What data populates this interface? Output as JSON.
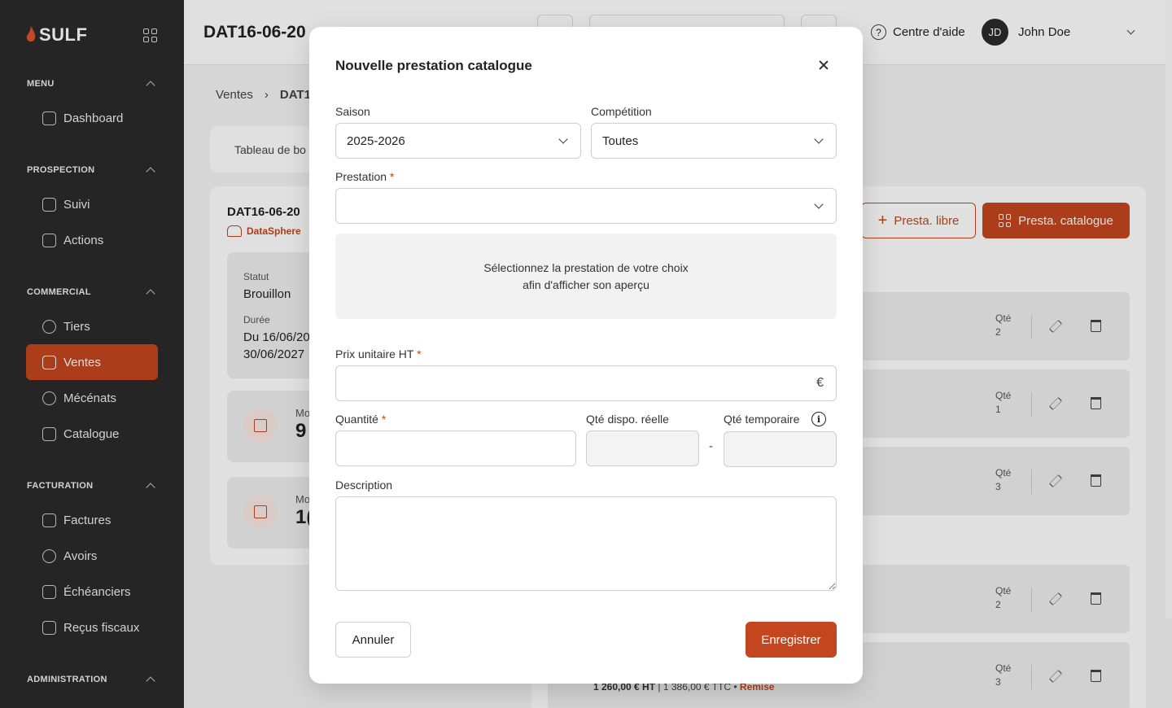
{
  "sidebar": {
    "brand": "SULF",
    "sections": {
      "menu": "MENU",
      "prospection": "PROSPECTION",
      "commercial": "COMMERCIAL",
      "facturation": "FACTURATION",
      "administration": "ADMINISTRATION"
    },
    "items": {
      "dashboard": "Dashboard",
      "suivi": "Suivi",
      "actions": "Actions",
      "tiers": "Tiers",
      "ventes": "Ventes",
      "mecenats": "Mécénats",
      "catalogue": "Catalogue",
      "factures": "Factures",
      "avoirs": "Avoirs",
      "echeanciers": "Échéanciers",
      "recus": "Reçus fiscaux"
    }
  },
  "header": {
    "title": "DAT16-06-20",
    "help": "Centre d'aide",
    "user_initials": "JD",
    "user_name": "John Doe"
  },
  "background": {
    "breadcrumb_root": "Ventes",
    "breadcrumb_current": "DAT16",
    "tab_label": "Tableau de bo",
    "doc_title": "DAT16-06-20",
    "client": "DataSphere",
    "status_label": "Statut",
    "status_value": "Brouillon",
    "duration_label": "Durée",
    "duration_line1": "Du 16/06/20",
    "duration_line2": "30/06/2027",
    "amount1_label": "Mo",
    "amount1_value": "9",
    "amount2_label": "Mo",
    "amount2_value": "1(",
    "btn_libre": "Presta. libre",
    "btn_catalogue": "Presta. catalogue",
    "qty_label": "Qté",
    "rows": [
      "2",
      "1",
      "3",
      "2",
      "3"
    ],
    "bottom_ht": "1 260,00 € HT",
    "bottom_ttc": "1 386,00 € TTC",
    "bottom_remise": "Remise"
  },
  "modal": {
    "title": "Nouvelle prestation catalogue",
    "saison_label": "Saison",
    "saison_value": "2025-2026",
    "competition_label": "Compétition",
    "competition_value": "Toutes",
    "prestation_label": "Prestation",
    "required_mark": "*",
    "preview_line1": "Sélectionnez la prestation de votre choix",
    "preview_line2": "afin d'afficher son aperçu",
    "prix_label": "Prix unitaire HT",
    "currency": "€",
    "quantite_label": "Quantité",
    "dispo_label": "Qté dispo. réelle",
    "temp_label": "Qté temporaire",
    "separator": "-",
    "description_label": "Description",
    "cancel": "Annuler",
    "save": "Enregistrer"
  },
  "colors": {
    "accent": "#c4461f",
    "sidebar": "#2b2b2b"
  }
}
